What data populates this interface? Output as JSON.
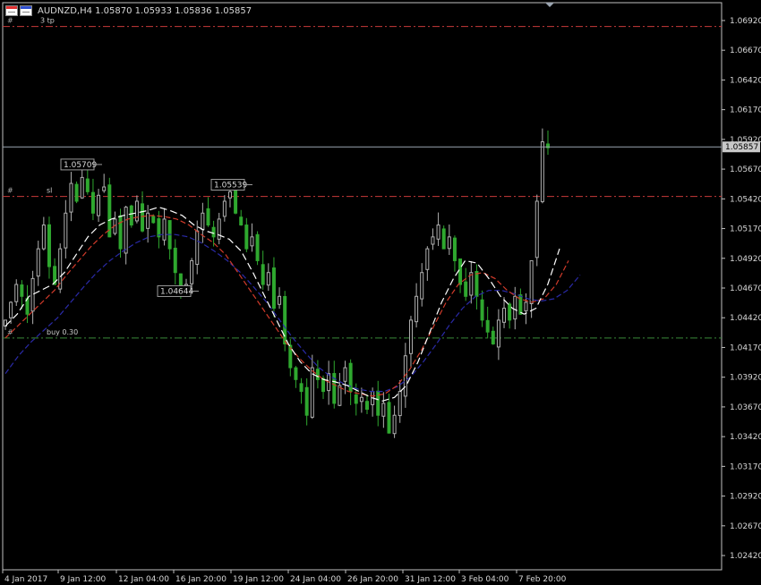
{
  "header": {
    "symbol_info": "AUDNZD,H4  1.05870 1.05933 1.05836 1.05857"
  },
  "price_axis": {
    "labels": [
      "1.06920",
      "1.06670",
      "1.06420",
      "1.06170",
      "1.05920",
      "1.05670",
      "1.05420",
      "1.05170",
      "1.04920",
      "1.04670",
      "1.04420",
      "1.04170",
      "1.03920",
      "1.03670",
      "1.03420",
      "1.03170",
      "1.02920",
      "1.02670",
      "1.02420"
    ],
    "current_price": "1.05857"
  },
  "time_axis": {
    "labels": [
      "4 Jan 2017",
      "9 Jan 12:00",
      "12 Jan 04:00",
      "16 Jan 20:00",
      "19 Jan 12:00",
      "24 Jan 04:00",
      "26 Jan 20:00",
      "31 Jan 12:00",
      "3 Feb 04:00",
      "7 Feb 20:00"
    ]
  },
  "levels": [
    {
      "name": "tp",
      "label": "# 3 tp",
      "left_label": "#",
      "right_label": "3 tp",
      "price": 1.0687,
      "color": "#c83a3a"
    },
    {
      "name": "sl",
      "label": "# sl",
      "left_label": "#",
      "right_label": "sl",
      "price": 1.0544,
      "color": "#c83a3a"
    },
    {
      "name": "buy",
      "label": "# buy 0.30",
      "left_label": "#",
      "right_label": "buy 0.30",
      "price": 1.0425,
      "color": "#3a8a3a"
    }
  ],
  "price_labels": [
    {
      "text": "1.05709",
      "price": 1.05709
    },
    {
      "text": "1.05539",
      "price": 1.05539
    },
    {
      "text": "1.04644",
      "price": 1.04644
    }
  ],
  "chart_data": {
    "type": "candlestick",
    "symbol": "AUDNZD",
    "timeframe": "H4",
    "ylim": [
      1.023,
      1.0707
    ],
    "bid": 1.05857,
    "colors": {
      "up": "#b0b0b0",
      "down": "#2fa82f",
      "ma_fast": "#ffffff",
      "ma_mid": "#d03a2a",
      "ma_slow": "#2a2aa8",
      "grid": "none"
    },
    "x": [
      "4 Jan 2017",
      "9 Jan 12:00",
      "12 Jan 04:00",
      "16 Jan 20:00",
      "19 Jan 12:00",
      "24 Jan 04:00",
      "26 Jan 20:00",
      "31 Jan 12:00",
      "3 Feb 04:00",
      "7 Feb 20:00"
    ],
    "close_trace": [
      1.044,
      1.0455,
      1.047,
      1.046,
      1.0445,
      1.0475,
      1.05,
      1.052,
      1.0485,
      1.047,
      1.05,
      1.053,
      1.0555,
      1.054,
      1.056,
      1.0548,
      1.053,
      1.0545,
      1.0552,
      1.051,
      1.0525,
      1.05,
      1.0535,
      1.052,
      1.054,
      1.0515,
      1.053,
      1.0522,
      1.051,
      1.0525,
      1.05,
      1.048,
      1.0464,
      1.047,
      1.049,
      1.0515,
      1.053,
      1.052,
      1.051,
      1.0525,
      1.054,
      1.0548,
      1.053,
      1.052,
      1.05,
      1.051,
      1.049,
      1.047,
      1.048,
      1.045,
      1.046,
      1.042,
      1.04,
      1.039,
      1.038,
      1.036,
      1.04,
      1.039,
      1.038,
      1.0395,
      1.037,
      1.0385,
      1.04,
      1.038,
      1.037,
      1.0375,
      1.0365,
      1.038,
      1.036,
      1.037,
      1.0345,
      1.036,
      1.038,
      1.041,
      1.044,
      1.046,
      1.048,
      1.05,
      1.051,
      1.052,
      1.05,
      1.051,
      1.049,
      1.047,
      1.046,
      1.048,
      1.046,
      1.044,
      1.043,
      1.042,
      1.044,
      1.045,
      1.044,
      1.046,
      1.0445,
      1.0455,
      1.049,
      1.054,
      1.059,
      1.0585
    ],
    "ma_fast_trace": [
      1.0435,
      1.0445,
      1.046,
      1.0465,
      1.047,
      1.048,
      1.0495,
      1.051,
      1.052,
      1.0525,
      1.0528,
      1.053,
      1.0532,
      1.0535,
      1.0532,
      1.0528,
      1.052,
      1.0515,
      1.0512,
      1.0508,
      1.0498,
      1.048,
      1.046,
      1.044,
      1.042,
      1.0405,
      1.0395,
      1.039,
      1.0388,
      1.0385,
      1.038,
      1.0375,
      1.0372,
      1.0375,
      1.0385,
      1.0405,
      1.043,
      1.0455,
      1.0475,
      1.049,
      1.0488,
      1.0475,
      1.046,
      1.045,
      1.0445,
      1.045,
      1.047,
      1.05
    ],
    "ma_mid_trace": [
      1.0425,
      1.0435,
      1.0445,
      1.0455,
      1.0465,
      1.0478,
      1.049,
      1.0502,
      1.0512,
      1.052,
      1.0525,
      1.0527,
      1.0528,
      1.0527,
      1.0525,
      1.052,
      1.0512,
      1.0505,
      1.0495,
      1.048,
      1.0465,
      1.045,
      1.0435,
      1.042,
      1.0408,
      1.0398,
      1.039,
      1.0385,
      1.038,
      1.0378,
      1.0376,
      1.0378,
      1.0385,
      1.0398,
      1.0415,
      1.0435,
      1.0455,
      1.047,
      1.0478,
      1.048,
      1.0475,
      1.0465,
      1.0458,
      1.0455,
      1.0458,
      1.047,
      1.049
    ],
    "ma_slow_trace": [
      1.0395,
      1.041,
      1.0422,
      1.0432,
      1.0442,
      1.0455,
      1.0468,
      1.048,
      1.049,
      1.0498,
      1.0505,
      1.051,
      1.0512,
      1.0512,
      1.051,
      1.0505,
      1.0498,
      1.049,
      1.048,
      1.0468,
      1.0455,
      1.044,
      1.0425,
      1.0412,
      1.04,
      1.0392,
      1.0386,
      1.0382,
      1.038,
      1.038,
      1.0384,
      1.0392,
      1.0405,
      1.042,
      1.0436,
      1.045,
      1.046,
      1.0465,
      1.0465,
      1.0462,
      1.0458,
      1.0456,
      1.0458,
      1.0465,
      1.0478
    ]
  }
}
